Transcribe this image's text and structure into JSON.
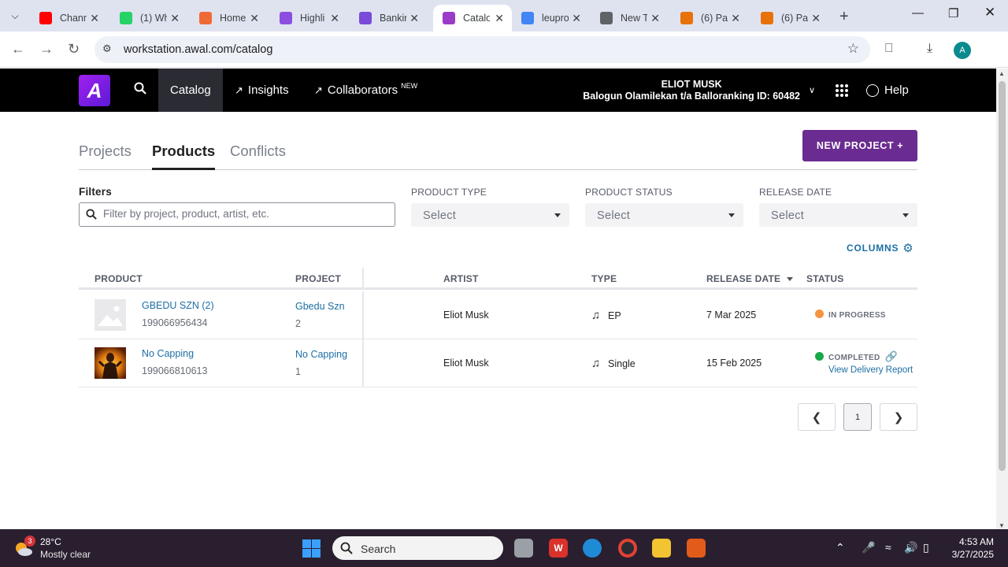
{
  "browser": {
    "tabs": [
      {
        "title": "Chann",
        "favicon": "youtube-icon",
        "color": "#ff0000"
      },
      {
        "title": "(1) Wh",
        "favicon": "whatsapp-icon",
        "color": "#25d366"
      },
      {
        "title": "Home",
        "favicon": "slides-icon",
        "color": "#f06a35"
      },
      {
        "title": "Highli",
        "favicon": "app-icon",
        "color": "#8c4ee0"
      },
      {
        "title": "Bankin",
        "favicon": "bank-icon",
        "color": "#7a4ad8"
      },
      {
        "title": "Catalo",
        "favicon": "catalog-icon",
        "color": "#9b3cc8"
      },
      {
        "title": "leupro",
        "favicon": "google-icon",
        "color": "#4285f4"
      },
      {
        "title": "New T",
        "favicon": "chrome-icon",
        "color": "#5f6368"
      },
      {
        "title": "(6) Pa",
        "favicon": "loading-icon",
        "color": "#e8710a"
      },
      {
        "title": "(6) Pa",
        "favicon": "loading-icon",
        "color": "#e8710a"
      }
    ],
    "url": "workstation.awal.com/catalog",
    "profile_initial": "A"
  },
  "app": {
    "logo_text": "A",
    "nav": {
      "catalog": "Catalog",
      "insights": "Insights",
      "collaborators": "Collaborators",
      "collaborators_badge": "NEW"
    },
    "user": {
      "name": "ELIOT MUSK",
      "account": "Balogun Olamilekan t/a Balloranking ID: 60482"
    },
    "help": "Help"
  },
  "page": {
    "tabs": {
      "projects": "Projects",
      "products": "Products",
      "conflicts": "Conflicts"
    },
    "new_project": "NEW PROJECT +",
    "filters": {
      "label": "Filters",
      "search_placeholder": "Filter by project, product, artist, etc.",
      "product_type_label": "PRODUCT TYPE",
      "product_type_value": "Select",
      "product_status_label": "PRODUCT STATUS",
      "product_status_value": "Select",
      "release_date_label": "RELEASE DATE",
      "release_date_value": "Select"
    },
    "columns_button": "COLUMNS",
    "table": {
      "headers": {
        "product": "PRODUCT",
        "project": "PROJECT",
        "artist": "ARTIST",
        "type": "TYPE",
        "release_date": "RELEASE DATE",
        "status": "STATUS"
      },
      "rows": [
        {
          "product": "GBEDU SZN (2)",
          "product_id": "199066956434",
          "project": "Gbedu Szn",
          "project_num": "2",
          "artist": "Eliot Musk",
          "type": "EP",
          "release_date": "7 Mar 2025",
          "status": "IN PROGRESS",
          "status_color": "#f59342",
          "status_link": ""
        },
        {
          "product": "No Capping",
          "product_id": "199066810613",
          "project": "No Capping",
          "project_num": "1",
          "artist": "Eliot Musk",
          "type": "Single",
          "release_date": "15 Feb 2025",
          "status": "COMPLETED",
          "status_color": "#1aa64a",
          "status_link": "View Delivery Report"
        }
      ]
    },
    "pagination": {
      "current": "1"
    }
  },
  "taskbar": {
    "weather_badge": "3",
    "temperature": "28°C",
    "condition": "Mostly clear",
    "search_label": "Search",
    "time": "4:53 AM",
    "date": "3/27/2025"
  }
}
